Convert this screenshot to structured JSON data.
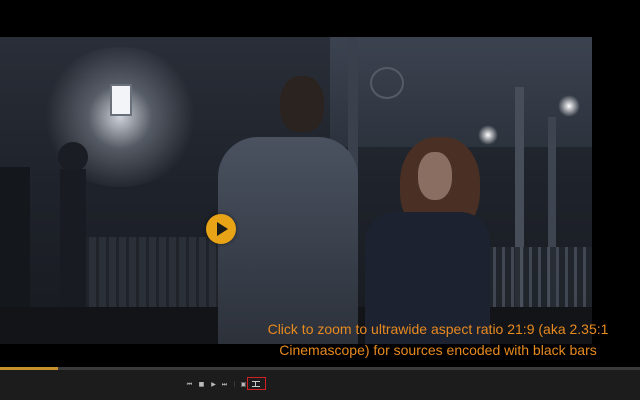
{
  "player": {
    "play_icon": "play-icon",
    "progress_fraction": 0.09
  },
  "caption": {
    "line1": "Click to zoom to ultrawide aspect ratio 21:9 (aka 2.35:1",
    "line2": "Cinemascope) for sources encoded with black bars"
  },
  "controls": {
    "icons": [
      "skip-back-icon",
      "stop-icon",
      "play-icon",
      "next-icon",
      "fullscreen-icon",
      "picture-in-picture-icon",
      "ultrawide-zoom-icon"
    ],
    "highlight_color": "#d12020"
  },
  "colors": {
    "accent": "#e8a317",
    "caption": "#e88a1f"
  }
}
